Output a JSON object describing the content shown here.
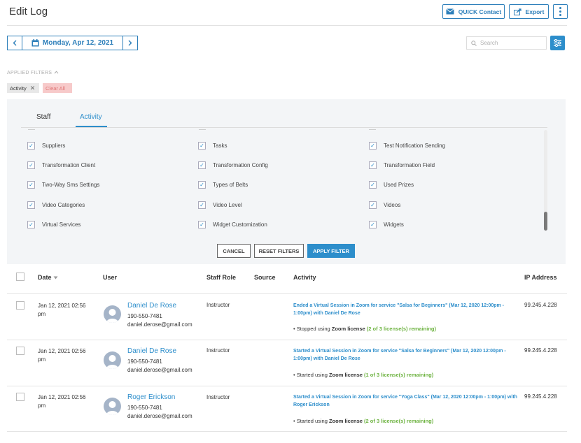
{
  "header": {
    "title": "Edit Log",
    "quick_contact_label": "QUICK Contact",
    "export_label": "Export",
    "more_icon": "kebab-icon"
  },
  "date_nav": {
    "date": "Monday, Apr 12, 2021"
  },
  "search": {
    "placeholder": "Search"
  },
  "applied_filters": {
    "label": "APPLIED FILTERS",
    "chips": [
      {
        "label": "Activity"
      }
    ],
    "clear_all_label": "Clear All"
  },
  "filter_panel": {
    "tabs": [
      {
        "label": "Staff"
      },
      {
        "label": "Activity"
      }
    ],
    "active_tab": "Activity",
    "columns": [
      [
        "Suppliers",
        "Transformation Client",
        "Two-Way Sms Settings",
        "Video Categories",
        "Virtual Services"
      ],
      [
        "Tasks",
        "Transformation Config",
        "Types of Belts",
        "Video Level",
        "Widget Customization"
      ],
      [
        "Test Notification Sending",
        "Transformation Field",
        "Used Prizes",
        "Videos",
        "Widgets"
      ]
    ],
    "cancel_label": "CANCEL",
    "reset_label": "RESET FILTERS",
    "apply_label": "APPLY FILTER"
  },
  "table": {
    "headers": {
      "date": "Date",
      "user": "User",
      "staff_role": "Staff Role",
      "source": "Source",
      "activity": "Activity",
      "ip": "IP Address"
    },
    "rows": [
      {
        "date": "Jan 12, 2021 02:56",
        "time_suffix": "pm",
        "user_name": "Daniel De Rose",
        "phone": "190-550-7481",
        "email": "daniel.derose@gmail.com",
        "role": "Instructor",
        "activity_title": "Ended a Virtual Session in Zoom for service \"Salsa for Beginners\" (Mar 12, 2020 12:00pm - 1:00pm) with Daniel De Rose",
        "note_prefix": "• Stopped using ",
        "note_bold": "Zoom license",
        "note_green": "(2 of 3 license(s) remaining)",
        "ip": "99.245.4.228"
      },
      {
        "date": "Jan 12, 2021 02:56",
        "time_suffix": "pm",
        "user_name": "Daniel De Rose",
        "phone": "190-550-7481",
        "email": "daniel.derose@gmail.com",
        "role": "Instructor",
        "activity_title": "Started a Virtual Session in Zoom for service \"Salsa for Beginners\" (Mar 12, 2020 12:00pm - 1:00pm) with Daniel De Rose",
        "note_prefix": "• Started using ",
        "note_bold": "Zoom license",
        "note_green": "(1 of 3 license(s) remaining)",
        "ip": "99.245.4.228"
      },
      {
        "date": "Jan 12, 2021 02:56",
        "time_suffix": "pm",
        "user_name": "Roger Erickson",
        "phone": "190-550-7481",
        "email": "daniel.derose@gmail.com",
        "role": "Instructor",
        "activity_title": "Started a Virtual Session in Zoom for service \"Yoga Class\" (Mar 12, 2020 12:00pm - 1:00pm) with Roger Erickson",
        "note_prefix": "• Started using ",
        "note_bold": "Zoom license",
        "note_green": "(2 of 3 license(s) remaining)",
        "ip": "99.245.4.228"
      }
    ]
  },
  "colors": {
    "accent": "#2d8ecb",
    "success": "#6cb23f",
    "clear_bg": "#f7caca"
  }
}
